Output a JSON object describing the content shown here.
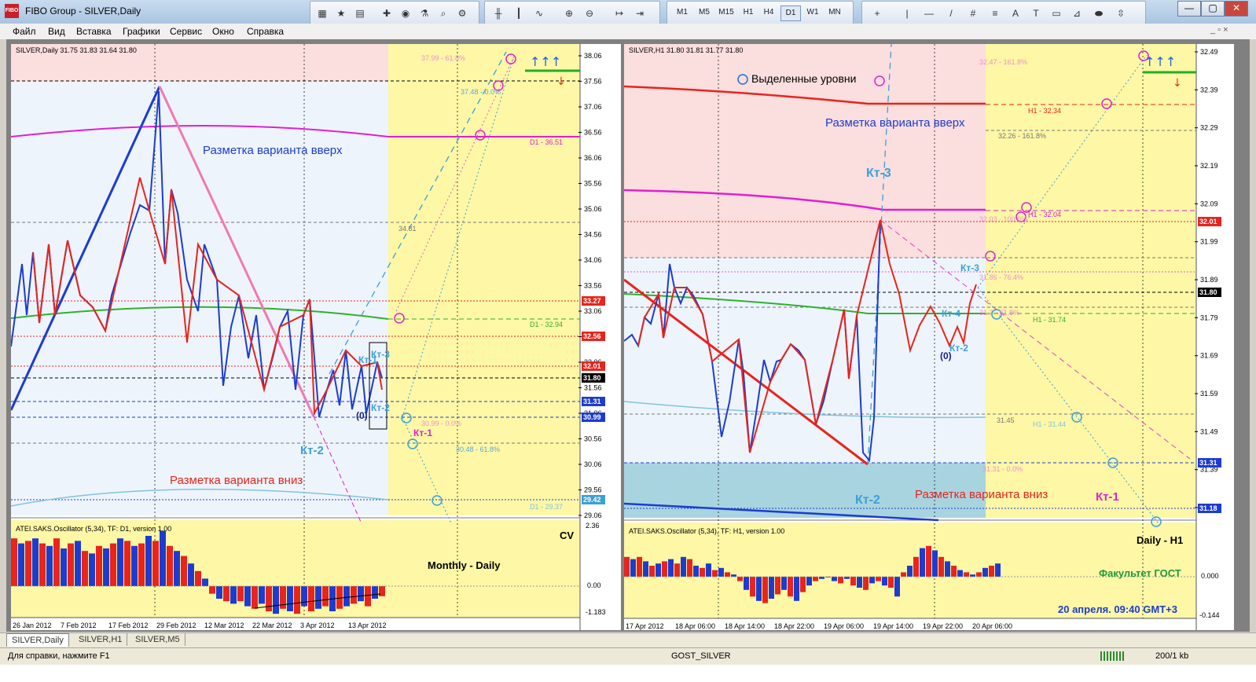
{
  "window": {
    "title": "FIBO Group - SILVER,Daily",
    "logo_text": "FIBO"
  },
  "toolbar": {
    "timeframes": [
      "M1",
      "M5",
      "M15",
      "H1",
      "H4",
      "D1",
      "W1",
      "MN"
    ],
    "active_timeframe": "D1",
    "draw_tools": [
      "+",
      "|",
      "—",
      "/",
      "#",
      "A",
      "T"
    ]
  },
  "window_controls": [
    "—",
    "▢",
    "✕"
  ],
  "menu": [
    "Файл",
    "Вид",
    "Вставка",
    "Графики",
    "Сервис",
    "Окно",
    "Справка"
  ],
  "left_chart": {
    "header": "SILVER,Daily  31.75 31.83 31.64 31.80",
    "price_scale": [
      "38.06",
      "37.56",
      "37.06",
      "36.56",
      "36.06",
      "35.56",
      "35.06",
      "34.56",
      "34.06",
      "33.56",
      "33.06",
      "32.56",
      "32.06",
      "31.56",
      "31.06",
      "30.56",
      "30.06",
      "29.56",
      "29.06"
    ],
    "price_tags": [
      {
        "value": "33.27",
        "color": "#e8241c"
      },
      {
        "value": "32.56",
        "color": "#e8241c"
      },
      {
        "value": "32.01",
        "color": "#e8241c"
      },
      {
        "value": "31.80",
        "color": "#000000"
      },
      {
        "value": "31.31",
        "color": "#1c3cd0"
      },
      {
        "value": "30.99",
        "color": "#1c3cd0"
      },
      {
        "value": "29.42",
        "color": "#3ca0d8"
      }
    ],
    "level_labels": [
      "37.99 - 61.8%",
      "37.48 - 0.0%",
      "D1 - 36.51",
      "34.81",
      "D1 - 32.94",
      "30.99 - 0.0%",
      "30.48 - 61.8%",
      "D1 - 29.37"
    ],
    "texts": {
      "up": "Разметка варианта вверх",
      "down": "Разметка варианта вниз",
      "kt1": "Кт-1",
      "kt2": "Кт-2",
      "kt3": "Кт-3",
      "kt2_small": "Кт-2",
      "kt1_magenta": "Кт-1",
      "zero": "(0)"
    },
    "oscillator": {
      "header": "ATEI.SAKS.Oscillator (5,34), TF: D1, version 1.00",
      "scale": [
        "2.36",
        "0.00",
        "-1.183"
      ],
      "label_cv": "CV",
      "label_period": "Monthly - Daily",
      "values": [
        1.9,
        1.7,
        1.8,
        1.9,
        1.7,
        1.6,
        1.9,
        1.5,
        1.7,
        1.8,
        1.4,
        1.3,
        1.6,
        1.5,
        1.7,
        1.9,
        1.8,
        1.6,
        1.7,
        2.0,
        1.8,
        2.2,
        1.6,
        1.4,
        1.2,
        0.9,
        0.6,
        0.3,
        -0.3,
        -0.5,
        -0.6,
        -0.7,
        -0.6,
        -0.8,
        -0.9,
        -0.7,
        -1.0,
        -1.1,
        -0.9,
        -1.0,
        -1.1,
        -0.8,
        -1.0,
        -0.9,
        -0.8,
        -1.0,
        -0.9,
        -0.8,
        -0.7,
        -0.6,
        -0.8,
        -0.5,
        -0.4
      ]
    },
    "dates": [
      "26 Jan 2012",
      "7 Feb 2012",
      "17 Feb 2012",
      "29 Feb 2012",
      "12 Mar 2012",
      "22 Mar 2012",
      "3 Apr 2012",
      "13 Apr 2012"
    ]
  },
  "right_chart": {
    "header": "SILVER,H1  31.80 31.81 31.77 31.80",
    "price_scale": [
      "32.49",
      "32.39",
      "32.29",
      "32.19",
      "32.09",
      "31.99",
      "31.89",
      "31.79",
      "31.69",
      "31.59",
      "31.49",
      "31.39",
      "31.29"
    ],
    "price_tags": [
      {
        "value": "32.01",
        "color": "#e8241c"
      },
      {
        "value": "31.80",
        "color": "#000000"
      },
      {
        "value": "31.31",
        "color": "#1c3cd0"
      },
      {
        "value": "31.18",
        "color": "#1c3cd0"
      }
    ],
    "level_labels": [
      "32.47 - 161.8%",
      "H1 - 32.34",
      "32.26 - 161.8%",
      "H1 - 32.04",
      "32.03 - 100.0%",
      "31.86 - 76.4%",
      "31.7 - 61.8%",
      "H1 - 31.74",
      "31.45",
      "H1 - 31.44",
      "31.31 - 0.0%"
    ],
    "texts": {
      "legend": "Выделенные уровни",
      "up": "Разметка варианта вверх",
      "down": "Разметка варианта вниз",
      "kt1": "Кт-1",
      "kt2": "Кт-2",
      "kt3": "Кт-3",
      "kt3_small": "Кт-3",
      "kt4": "Кт-4",
      "kt2_small": "Кт-2",
      "zero": "(0)"
    },
    "oscillator": {
      "header": "ATEI.SAKS.Oscillator (5,34), TF: H1, version 1.00",
      "scale": [
        "0.000",
        "-0.144"
      ],
      "label_period": "Daily - H1",
      "label_faculty": "Факультет ГОСТ",
      "label_date": "20 апреля. 09:40 GMT+3",
      "values": [
        0.09,
        0.08,
        0.09,
        0.07,
        0.05,
        0.06,
        0.07,
        0.08,
        0.06,
        0.09,
        0.08,
        0.05,
        0.04,
        0.06,
        0.03,
        0.04,
        0.02,
        0.01,
        -0.02,
        -0.06,
        -0.09,
        -0.11,
        -0.12,
        -0.1,
        -0.08,
        -0.06,
        -0.09,
        -0.11,
        -0.07,
        -0.04,
        -0.02,
        -0.01,
        0.0,
        -0.02,
        -0.03,
        -0.01,
        -0.04,
        -0.05,
        -0.06,
        -0.03,
        -0.02,
        -0.04,
        -0.05,
        -0.09,
        0.02,
        0.05,
        0.09,
        0.13,
        0.14,
        0.12,
        0.09,
        0.07,
        0.05,
        0.03,
        0.02,
        0.01,
        0.02,
        0.04,
        0.05,
        0.06
      ]
    },
    "dates": [
      "17 Apr 2012",
      "18 Apr 06:00",
      "18 Apr 14:00",
      "18 Apr 22:00",
      "19 Apr 06:00",
      "19 Apr 14:00",
      "19 Apr 22:00",
      "20 Apr 06:00"
    ]
  },
  "tabs": [
    "SILVER,Daily",
    "SILVER,H1",
    "SILVER,M5"
  ],
  "active_tab": "SILVER,Daily",
  "status": {
    "help": "Для справки, нажмите F1",
    "profile": "GOST_SILVER",
    "traffic": "200/1 kb"
  }
}
